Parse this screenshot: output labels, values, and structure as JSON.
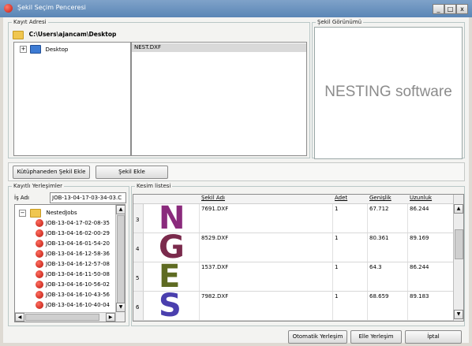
{
  "window": {
    "title": "Şekil Seçim Penceresi",
    "controls": [
      "_",
      "□",
      "x"
    ]
  },
  "kayit": {
    "legend": "Kayıt Adresi",
    "path": "C:\\Users\\ajancam\\Desktop",
    "tree_item": "Desktop",
    "file": "NEST.DXF"
  },
  "preview": {
    "legend": "Şekil Görünümü",
    "text": "NESTING software"
  },
  "toolbar": {
    "library_button": "Kütüphaneden Şekil Ekle",
    "add_button": "Şekil Ekle"
  },
  "layouts": {
    "legend": "Kayıtlı Yerleşimler",
    "job_label": "İş Adı",
    "job_value": "JOB-13-04-17-03-34-03.C",
    "folder": "NestedJobs",
    "jobs": [
      "JOB-13-04-17-02-08-35",
      "JOB-13-04-16-02-00-29",
      "JOB-13-04-16-01-54-20",
      "JOB-13-04-16-12-58-36",
      "JOB-13-04-16-12-57-08",
      "JOB-13-04-16-11-50-08",
      "JOB-13-04-16-10-56-02",
      "JOB-13-04-16-10-43-56",
      "JOB-13-04-16-10-40-04"
    ]
  },
  "cutlist": {
    "legend": "Kesim listesi",
    "columns": [
      "Şekil Adı",
      "Adet",
      "Genişlik",
      "Uzunluk"
    ],
    "rows": [
      {
        "index": "3",
        "letter": "N",
        "color": "#8a2a7c",
        "name": "7691.DXF",
        "qty": "1",
        "width": "67.712",
        "length": "86.244"
      },
      {
        "index": "4",
        "letter": "G",
        "color": "#7a2a4c",
        "name": "8529.DXF",
        "qty": "1",
        "width": "80.361",
        "length": "89.169"
      },
      {
        "index": "5",
        "letter": "E",
        "color": "#5e6b22",
        "name": "1537.DXF",
        "qty": "1",
        "width": "64.3",
        "length": "86.244"
      },
      {
        "index": "6",
        "letter": "S",
        "color": "#4a3fae",
        "name": "7982.DXF",
        "qty": "1",
        "width": "68.659",
        "length": "89.183"
      }
    ]
  },
  "footer": {
    "auto_button": "Otomatik Yerleşim",
    "manual_button": "Elle Yerleşim",
    "cancel_button": "İptal"
  }
}
